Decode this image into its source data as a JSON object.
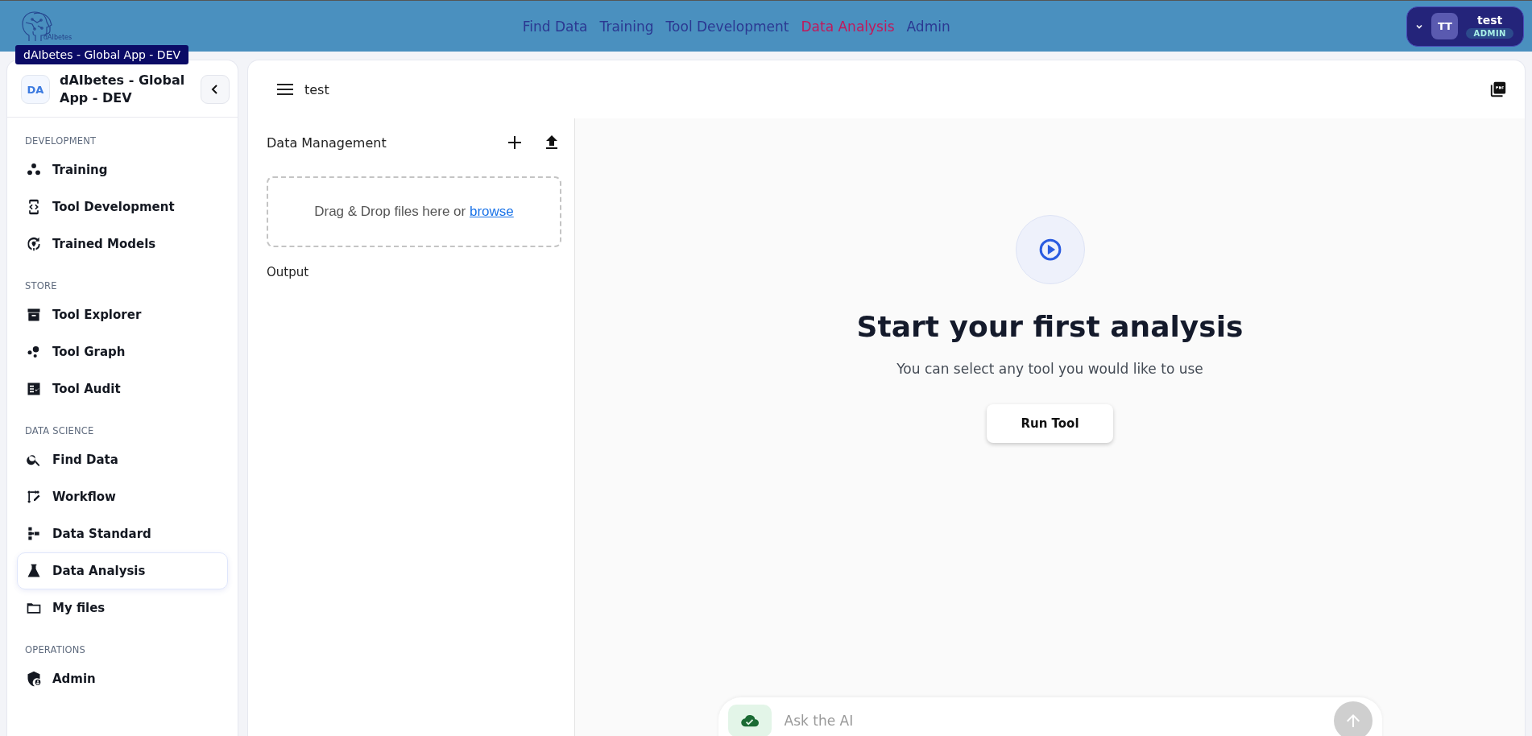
{
  "app": {
    "logo_text": "dAIbetes",
    "tooltip": "dAIbetes - Global App - DEV"
  },
  "nav": [
    {
      "label": "Find Data",
      "selected": false
    },
    {
      "label": "Training",
      "selected": false
    },
    {
      "label": "Tool Development",
      "selected": false
    },
    {
      "label": "Data Analysis",
      "selected": true
    },
    {
      "label": "Admin",
      "selected": false
    }
  ],
  "user": {
    "initials": "TT",
    "name": "test",
    "role": "ADMIN"
  },
  "sidebar": {
    "badge": "DA",
    "title": "dAIbetes - Global App - DEV",
    "sections": [
      {
        "label": "DEVELOPMENT",
        "items": [
          {
            "label": "Training",
            "kind": "dots",
            "selected": false
          },
          {
            "label": "Tool Development",
            "kind": "code",
            "selected": false
          },
          {
            "label": "Trained Models",
            "kind": "cycle",
            "selected": false
          }
        ]
      },
      {
        "label": "STORE",
        "items": [
          {
            "label": "Tool Explorer",
            "kind": "archive",
            "selected": false
          },
          {
            "label": "Tool Graph",
            "kind": "bubbles",
            "selected": false
          },
          {
            "label": "Tool Audit",
            "kind": "checklist",
            "selected": false
          }
        ]
      },
      {
        "label": "DATA SCIENCE",
        "items": [
          {
            "label": "Find Data",
            "kind": "search",
            "selected": false
          },
          {
            "label": "Workflow",
            "kind": "workflow",
            "selected": false
          },
          {
            "label": "Data Standard",
            "kind": "tree",
            "selected": false
          },
          {
            "label": "Data Analysis",
            "kind": "flask",
            "selected": true
          },
          {
            "label": "My files",
            "kind": "folder",
            "selected": false
          }
        ]
      },
      {
        "label": "OPERATIONS",
        "items": [
          {
            "label": "Admin",
            "kind": "shield",
            "selected": false
          }
        ]
      }
    ]
  },
  "workspace": {
    "title": "test",
    "data_management": "Data Management",
    "dropzone_text": "Drag & Drop files here or",
    "browse_link": "browse",
    "output": "Output"
  },
  "empty_state": {
    "title": "Start your first analysis",
    "subtitle": "You can select any tool you would like to use",
    "button": "Run Tool"
  },
  "chat": {
    "placeholder": "Ask the AI"
  }
}
